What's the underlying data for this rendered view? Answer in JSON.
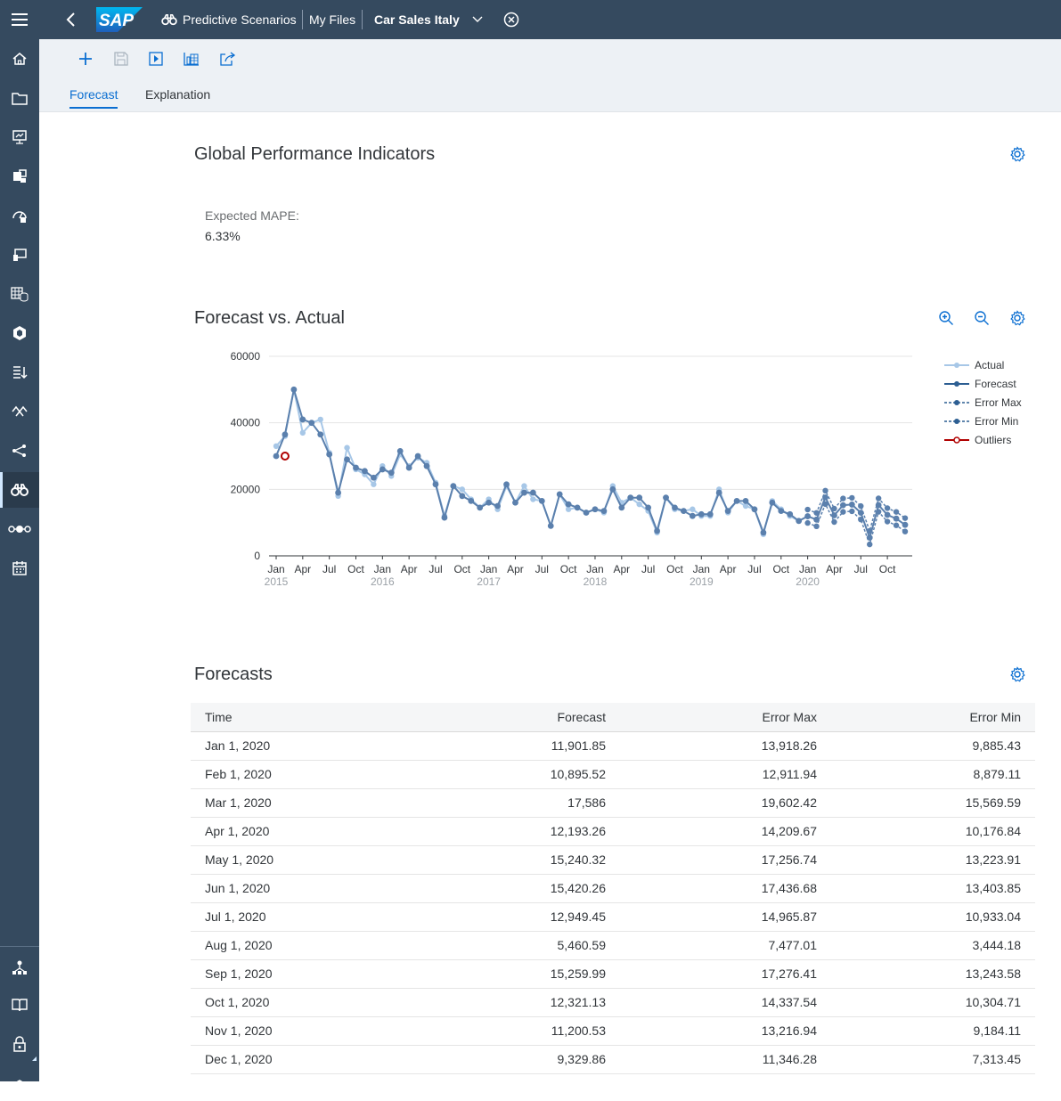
{
  "shell": {
    "breadcrumb_app": "Predictive Scenarios",
    "breadcrumb_files": "My Files",
    "file_title": "Car Sales Italy",
    "logo_text": "SAP"
  },
  "tabs": [
    {
      "label": "Forecast"
    },
    {
      "label": "Explanation"
    }
  ],
  "gpi": {
    "title": "Global Performance Indicators",
    "mape_label": "Expected MAPE:",
    "mape_value": "6.33%"
  },
  "chart_section": {
    "title": "Forecast vs. Actual"
  },
  "chart_data": {
    "type": "line",
    "ylim": [
      0,
      60000
    ],
    "yticks": [
      "0",
      "20000",
      "40000",
      "60000"
    ],
    "x_month_labels": [
      "Jan",
      "Apr",
      "Jul",
      "Oct",
      "Jan",
      "Apr",
      "Jul",
      "Oct",
      "Jan",
      "Apr",
      "Jul",
      "Oct",
      "Jan",
      "Apr",
      "Jul",
      "Oct",
      "Jan",
      "Apr",
      "Jul",
      "Oct",
      "Jan",
      "Apr",
      "Jul",
      "Oct"
    ],
    "x_year_labels": [
      "2015",
      "2016",
      "2017",
      "2018",
      "2019",
      "2020"
    ],
    "legend": [
      "Actual",
      "Forecast",
      "Error Max",
      "Error Min",
      "Outliers"
    ],
    "colors": {
      "actual": "#a7c7e7",
      "forecast": "#5b80ad",
      "outlier": "#b00000",
      "grid": "#e5e5e5"
    },
    "series": [
      {
        "name": "Actual",
        "values": [
          33000,
          36000,
          50000,
          37000,
          40000,
          41000,
          31000,
          18000,
          32500,
          26000,
          24500,
          21500,
          27000,
          24000,
          30500,
          27000,
          29500,
          28000,
          22000,
          12000,
          21000,
          20000,
          17000,
          14500,
          17000,
          14000,
          21000,
          16000,
          21000,
          17000,
          16500,
          9000,
          18500,
          14000,
          14500,
          13000,
          14000,
          13000,
          21000,
          16000,
          17500,
          15500,
          13500,
          7000,
          17500,
          14000,
          13500,
          14000,
          12000,
          12000,
          20000,
          13000,
          16500,
          15000,
          14000,
          6500,
          16500,
          14000,
          12000,
          10500
        ]
      },
      {
        "name": "Forecast",
        "values": [
          30000,
          36500,
          50000,
          41000,
          40000,
          36500,
          30500,
          19000,
          29000,
          26500,
          25500,
          23500,
          26000,
          25000,
          31500,
          26500,
          30000,
          27000,
          21500,
          11500,
          21000,
          18000,
          16500,
          14500,
          16000,
          15000,
          21500,
          16000,
          19000,
          19000,
          16500,
          9000,
          18500,
          15500,
          14500,
          13000,
          14000,
          13500,
          20000,
          14500,
          17500,
          17500,
          14500,
          7500,
          17500,
          14500,
          13500,
          12000,
          12500,
          12500,
          19000,
          13500,
          16500,
          16500,
          14000,
          7000,
          16000,
          13500,
          12500,
          10500,
          11901.85,
          10895.52,
          17586,
          12193.26,
          15240.32,
          15420.26,
          12949.45,
          5460.59,
          15259.99,
          12321.13,
          11200.53,
          9329.86
        ]
      },
      {
        "name": "Error Max",
        "start_index": 60,
        "values": [
          13918.26,
          12911.94,
          19602.42,
          14209.67,
          17256.74,
          17436.68,
          14965.87,
          7477.01,
          17276.41,
          14337.54,
          13216.94,
          11346.28
        ]
      },
      {
        "name": "Error Min",
        "start_index": 60,
        "values": [
          9885.43,
          8879.11,
          15569.59,
          10176.84,
          13223.91,
          13403.85,
          10933.04,
          3444.18,
          13243.58,
          10304.71,
          9184.11,
          7313.45
        ]
      },
      {
        "name": "Outliers",
        "points": [
          {
            "index": 1,
            "value": 30000
          }
        ]
      }
    ]
  },
  "forecasts": {
    "title": "Forecasts",
    "columns": [
      "Time",
      "Forecast",
      "Error Max",
      "Error Min"
    ],
    "rows": [
      [
        "Jan 1, 2020",
        "11,901.85",
        "13,918.26",
        "9,885.43"
      ],
      [
        "Feb 1, 2020",
        "10,895.52",
        "12,911.94",
        "8,879.11"
      ],
      [
        "Mar 1, 2020",
        "17,586",
        "19,602.42",
        "15,569.59"
      ],
      [
        "Apr 1, 2020",
        "12,193.26",
        "14,209.67",
        "10,176.84"
      ],
      [
        "May 1, 2020",
        "15,240.32",
        "17,256.74",
        "13,223.91"
      ],
      [
        "Jun 1, 2020",
        "15,420.26",
        "17,436.68",
        "13,403.85"
      ],
      [
        "Jul 1, 2020",
        "12,949.45",
        "14,965.87",
        "10,933.04"
      ],
      [
        "Aug 1, 2020",
        "5,460.59",
        "7,477.01",
        "3,444.18"
      ],
      [
        "Sep 1, 2020",
        "15,259.99",
        "17,276.41",
        "13,243.58"
      ],
      [
        "Oct 1, 2020",
        "12,321.13",
        "14,337.54",
        "10,304.71"
      ],
      [
        "Nov 1, 2020",
        "11,200.53",
        "13,216.94",
        "9,184.11"
      ],
      [
        "Dec 1, 2020",
        "9,329.86",
        "11,346.28",
        "7,313.45"
      ]
    ]
  }
}
